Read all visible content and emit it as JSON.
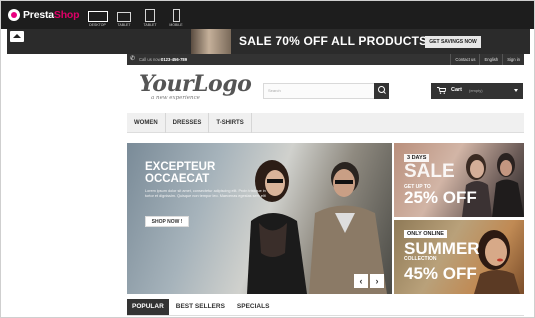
{
  "editor": {
    "brand_main": "Presta",
    "brand_accent": "Shop",
    "devices": [
      {
        "label": "DESKTOP",
        "icon": "desktop-icon",
        "active": true
      },
      {
        "label": "TABLET",
        "icon": "tablet-landscape-icon",
        "active": false
      },
      {
        "label": "TABLET",
        "icon": "tablet-portrait-icon",
        "active": false
      },
      {
        "label": "MOBILE",
        "icon": "mobile-icon",
        "active": false
      }
    ]
  },
  "promo": {
    "text": "SALE 70% OFF ALL PRODUCTS",
    "cta": "GET SAVINGS NOW"
  },
  "topnav": {
    "call_label": "Call us now:",
    "phone": "0123-456-789",
    "links": [
      "Contact us",
      "English",
      "Sign in"
    ]
  },
  "header": {
    "logo": "YourLogo",
    "tagline": "a new experience",
    "search_placeholder": "Search",
    "cart_label": "Cart",
    "cart_count": "(empty)"
  },
  "menu": {
    "items": [
      "WOMEN",
      "DRESSES",
      "T-SHIRTS"
    ]
  },
  "hero": {
    "title_line1": "EXCEPTEUR",
    "title_line2": "OCCAECAT",
    "body": "Lorem ipsum dolor sit amet, consectetur adipiscing elit. Proin tristique in tortor et dignissim. Quisque non tempor leo. Maecenas egestas sem elit",
    "button": "SHOP NOW !",
    "prev": "‹",
    "next": "›"
  },
  "banners": {
    "b1_tag": "3 DAYS",
    "b1_big": "SALE",
    "b1_upto": "GET UP TO",
    "b1_pct": "25% OFF",
    "b2_tag": "ONLY ONLINE",
    "b2_big": "SUMMER",
    "b2_coll": "COLLECTION",
    "b2_pct": "45% OFF"
  },
  "tabs": [
    "POPULAR",
    "BEST SELLERS",
    "SPECIALS"
  ],
  "colors": {
    "editor_bar": "#1d1d1d",
    "brand_accent": "#df0067",
    "nav_dark": "#333333",
    "menu_bg": "#f0f0f0"
  }
}
